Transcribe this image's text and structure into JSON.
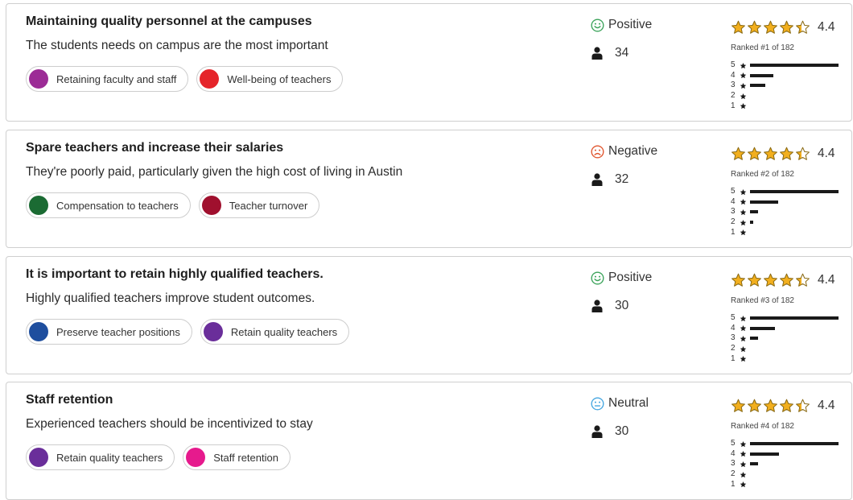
{
  "colors": {
    "star_fill": "#F2AF1E",
    "star_outline": "#8a6a14",
    "positive": "#3BA35A",
    "negative": "#E0552E",
    "neutral": "#45A6E0",
    "bar": "#1a1a1a"
  },
  "icons": {
    "participants": "person-icon",
    "positive": "smiley-icon",
    "negative": "frown-icon",
    "neutral": "neutral-face-icon",
    "star": "star-icon"
  },
  "cards": [
    {
      "title": "Maintaining quality personnel at the campuses",
      "description": "The students needs on campus are the most important",
      "tags": [
        {
          "label": "Retaining faculty and staff",
          "color": "#9C2C96"
        },
        {
          "label": "Well-being of teachers",
          "color": "#E5242A"
        }
      ],
      "sentiment": {
        "label": "Positive",
        "kind": "positive"
      },
      "participants": "34",
      "rating": {
        "value": "4.4",
        "score": 4.4,
        "rank": "Ranked #1 of 182"
      },
      "histogram": [
        {
          "stars": "5",
          "share": 1.0
        },
        {
          "stars": "4",
          "share": 0.26
        },
        {
          "stars": "3",
          "share": 0.17
        },
        {
          "stars": "2",
          "share": 0
        },
        {
          "stars": "1",
          "share": 0
        }
      ]
    },
    {
      "title": "Spare teachers and increase their salaries",
      "description": "They're poorly paid, particularly given the high cost of living in Austin",
      "tags": [
        {
          "label": "Compensation to teachers",
          "color": "#1B6B33"
        },
        {
          "label": "Teacher turnover",
          "color": "#A0102E"
        }
      ],
      "sentiment": {
        "label": "Negative",
        "kind": "negative"
      },
      "participants": "32",
      "rating": {
        "value": "4.4",
        "score": 4.4,
        "rank": "Ranked #2 of 182"
      },
      "histogram": [
        {
          "stars": "5",
          "share": 1.0
        },
        {
          "stars": "4",
          "share": 0.32
        },
        {
          "stars": "3",
          "share": 0.09
        },
        {
          "stars": "2",
          "share": 0.04
        },
        {
          "stars": "1",
          "share": 0
        }
      ]
    },
    {
      "title": "It is important to retain highly qualified teachers.",
      "description": "Highly qualified teachers improve student outcomes.",
      "tags": [
        {
          "label": "Preserve teacher positions",
          "color": "#1E4E9E"
        },
        {
          "label": "Retain quality teachers",
          "color": "#6A2E9A"
        }
      ],
      "sentiment": {
        "label": "Positive",
        "kind": "positive"
      },
      "participants": "30",
      "rating": {
        "value": "4.4",
        "score": 4.4,
        "rank": "Ranked #3 of 182"
      },
      "histogram": [
        {
          "stars": "5",
          "share": 1.0
        },
        {
          "stars": "4",
          "share": 0.28
        },
        {
          "stars": "3",
          "share": 0.09
        },
        {
          "stars": "2",
          "share": 0
        },
        {
          "stars": "1",
          "share": 0
        }
      ]
    },
    {
      "title": "Staff retention",
      "description": "Experienced teachers should be incentivized to stay",
      "tags": [
        {
          "label": "Retain quality teachers",
          "color": "#6A2E9A"
        },
        {
          "label": "Staff retention",
          "color": "#E61A8D"
        }
      ],
      "sentiment": {
        "label": "Neutral",
        "kind": "neutral"
      },
      "participants": "30",
      "rating": {
        "value": "4.4",
        "score": 4.4,
        "rank": "Ranked #4 of 182"
      },
      "histogram": [
        {
          "stars": "5",
          "share": 1.0
        },
        {
          "stars": "4",
          "share": 0.33
        },
        {
          "stars": "3",
          "share": 0.09
        },
        {
          "stars": "2",
          "share": 0
        },
        {
          "stars": "1",
          "share": 0
        }
      ]
    }
  ]
}
